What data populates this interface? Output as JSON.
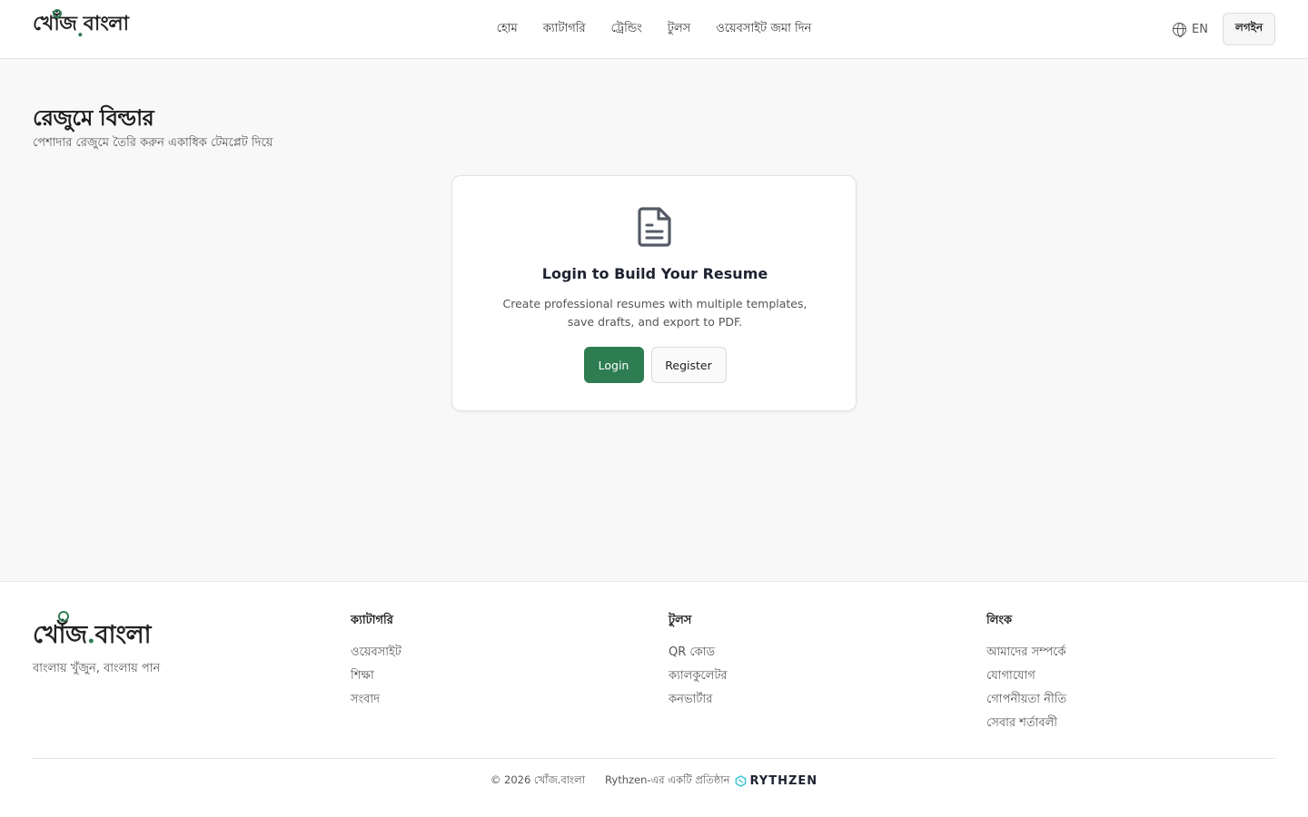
{
  "header": {
    "logo": {
      "main": "খোঁজ",
      "dot": ".",
      "suffix": "বাংলা"
    },
    "nav": [
      "হোম",
      "ক্যাটাগরি",
      "ট্রেন্ডিং",
      "টুলস",
      "ওয়েবসাইট জমা দিন"
    ],
    "lang_label": "EN",
    "login_label": "লগইন"
  },
  "page": {
    "title": "রেজুমে বিল্ডার",
    "subtitle": "পেশাদার রেজুমে তৈরি করুন একাধিক টেমপ্লেট দিয়ে"
  },
  "card": {
    "title": "Login to Build Your Resume",
    "description": "Create professional resumes with multiple templates, save drafts, and export to PDF.",
    "login_label": "Login",
    "register_label": "Register"
  },
  "footer": {
    "logo": {
      "main": "খোঁজ",
      "dot": ".",
      "suffix": "বাংলা"
    },
    "tagline": "বাংলায় খুঁজুন, বাংলায় পান",
    "columns": [
      {
        "title": "ক্যাটাগরি",
        "links": [
          "ওয়েবসাইট",
          "শিক্ষা",
          "সংবাদ"
        ]
      },
      {
        "title": "টুলস",
        "links": [
          "QR কোড",
          "ক্যালকুলেটর",
          "কনভার্টার"
        ]
      },
      {
        "title": "লিংক",
        "links": [
          "আমাদের সম্পর্কে",
          "যোগাযোগ",
          "গোপনীয়তা নীতি",
          "সেবার শর্তাবলী"
        ]
      }
    ],
    "copyright": "© 2026 খোঁজ.বাংলা",
    "rythzen_text": "Rythzen-এর একটি প্রতিষ্ঠান",
    "rythzen_brand": "RYTHZEN"
  },
  "colors": {
    "accent": "#2e7d52",
    "rythzen_mark": "#3ec6d8"
  }
}
